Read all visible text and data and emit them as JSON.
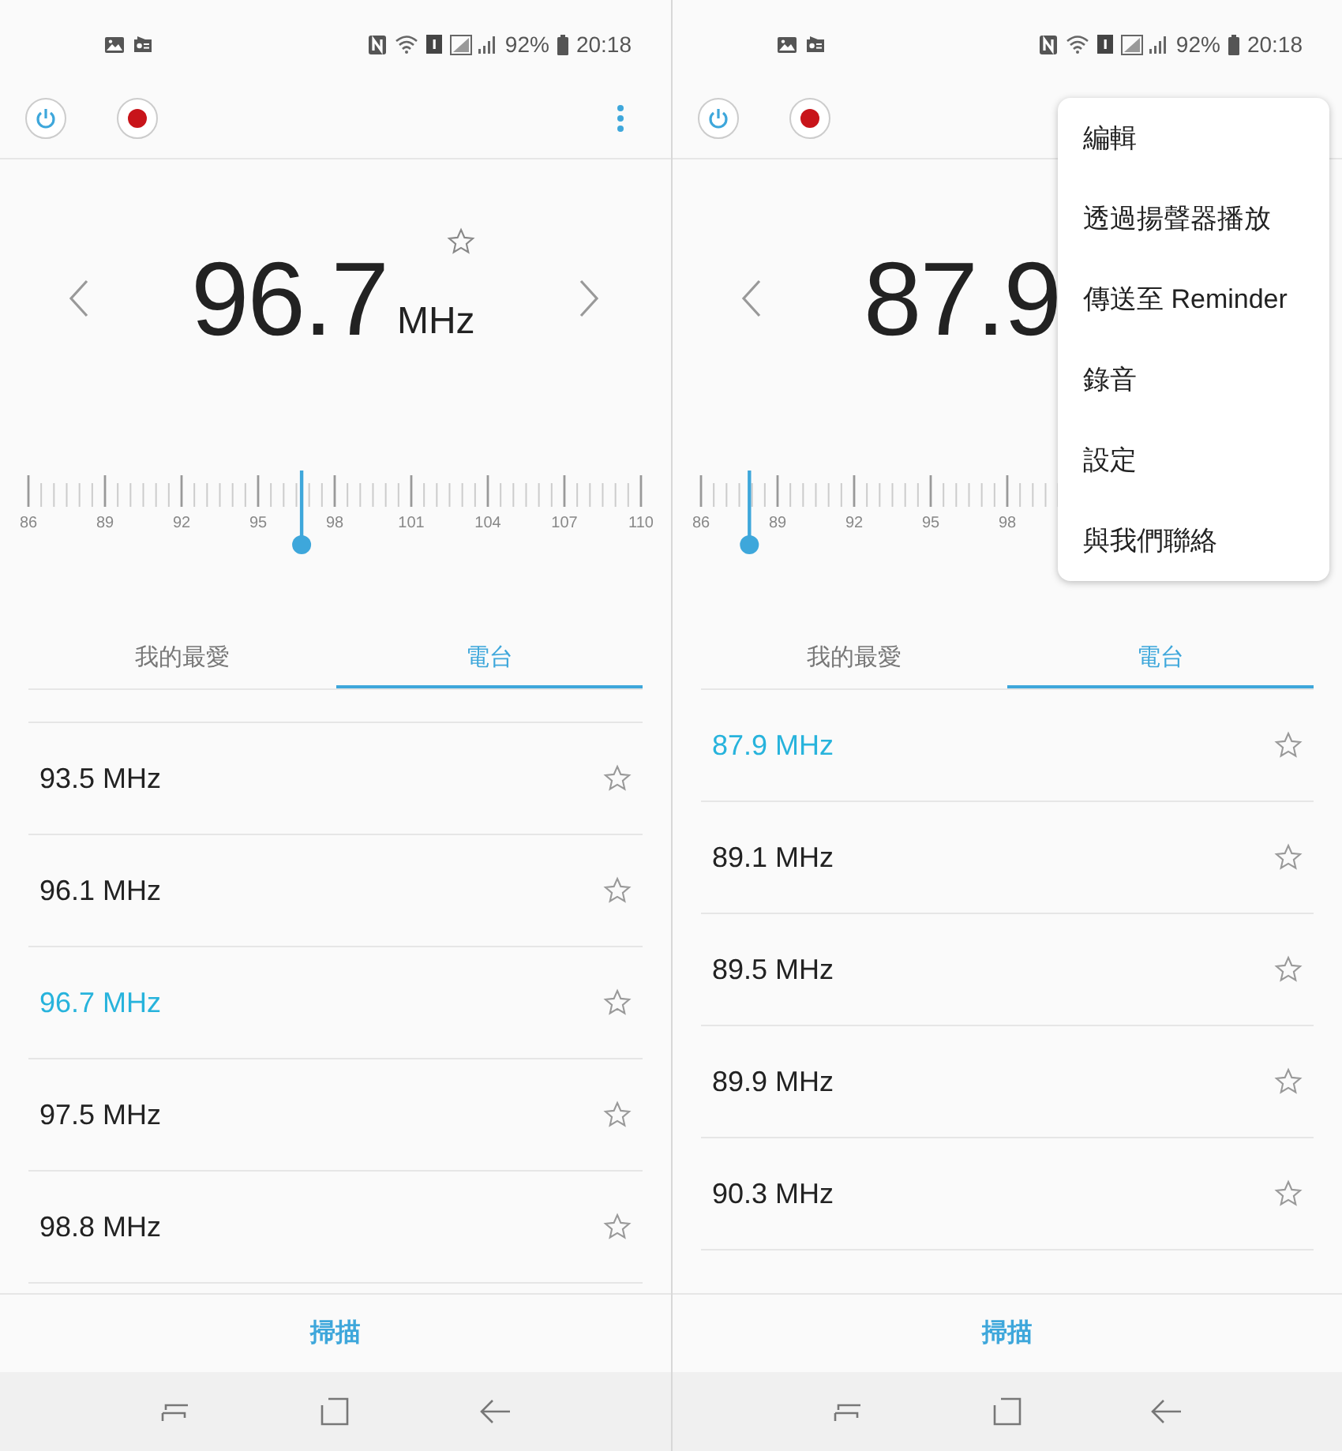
{
  "screens": [
    {
      "status_bar": {
        "battery": "92%",
        "time": "20:18"
      },
      "tuner": {
        "frequency": "96.7",
        "unit": "MHz",
        "favorite": false,
        "level": 0.446,
        "scale_labels": [
          "86",
          "89",
          "92",
          "95",
          "98",
          "101",
          "104",
          "107",
          "110"
        ]
      },
      "tabs": [
        {
          "label": "我的最愛",
          "selected": false
        },
        {
          "label": "電台",
          "selected": true
        }
      ],
      "stations": [
        {
          "label": "93.5 MHz",
          "selected": false
        },
        {
          "label": "96.1 MHz",
          "selected": false
        },
        {
          "label": "96.7 MHz",
          "selected": true
        },
        {
          "label": "97.5 MHz",
          "selected": false
        },
        {
          "label": "98.8 MHz",
          "selected": false
        }
      ],
      "scan_button": "掃描"
    },
    {
      "status_bar": {
        "battery": "92%",
        "time": "20:18"
      },
      "tuner": {
        "frequency": "87.9",
        "level": 0.079,
        "scale_labels": [
          "86",
          "89",
          "92",
          "95",
          "98"
        ]
      },
      "tabs": [
        {
          "label": "我的最愛",
          "selected": false
        },
        {
          "label": "電台",
          "selected": true
        }
      ],
      "stations": [
        {
          "label": "87.9 MHz",
          "selected": true
        },
        {
          "label": "89.1 MHz",
          "selected": false
        },
        {
          "label": "89.5 MHz",
          "selected": false
        },
        {
          "label": "89.9 MHz",
          "selected": false
        },
        {
          "label": "90.3 MHz",
          "selected": false
        }
      ],
      "scan_button": "掃描",
      "menu": [
        "編輯",
        "透過揚聲器播放",
        "傳送至 Reminder",
        "錄音",
        "設定",
        "與我們聯絡"
      ]
    }
  ]
}
